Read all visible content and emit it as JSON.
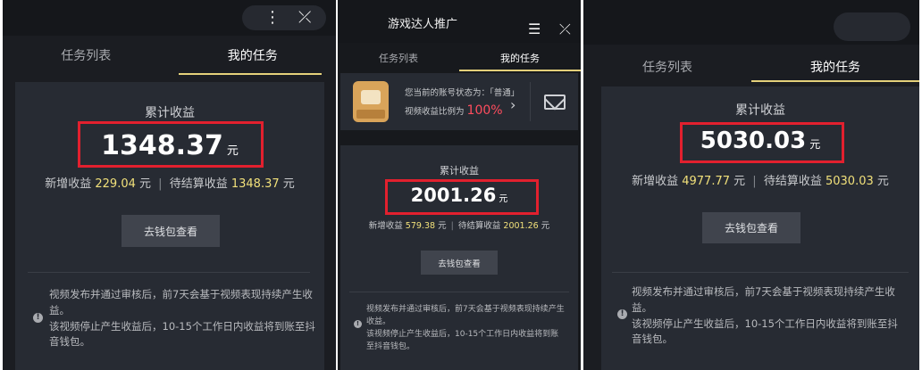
{
  "left": {
    "tabs": [
      "任务列表",
      "我的任务"
    ],
    "earnings_title": "累计收益",
    "amount": "1348.37",
    "unit": "元",
    "new_label": "新增收益",
    "new_value": "229.04",
    "pending_label": "待结算收益",
    "pending_value": "1348.37",
    "button": "去钱包查看",
    "notes": [
      "视频发布并通过审核后，前7天会基于视频表现持续产生收益。",
      "该视频停止产生收益后，10-15个工作日内收益将到账至抖音钱包。"
    ]
  },
  "middle": {
    "app_title": "游戏达人推广",
    "tabs": [
      "任务列表",
      "我的任务"
    ],
    "status_text": "您当前的账号状态为：「普通」",
    "ratio_label": "视频收益比例为",
    "ratio_value": "100%",
    "earnings_title": "累计收益",
    "amount": "2001.26",
    "unit": "元",
    "new_label": "新增收益",
    "new_value": "579.38",
    "pending_label": "待结算收益",
    "pending_value": "2001.26",
    "button": "去钱包查看",
    "notes": [
      "视频发布并通过审核后，前7天会基于视频表现持续产生收益。",
      "该视频停止产生收益后，10-15个工作日内收益将到账至抖音钱包。"
    ]
  },
  "right": {
    "tabs": [
      "任务列表",
      "我的任务"
    ],
    "earnings_title": "累计收益",
    "amount": "5030.03",
    "unit": "元",
    "new_label": "新增收益",
    "new_value": "4977.77",
    "pending_label": "待结算收益",
    "pending_value": "5030.03",
    "button": "去钱包查看",
    "notes": [
      "视频发布并通过审核后，前7天会基于视频表现持续产生收益。",
      "该视频停止产生收益后，10-15个工作日内收益将到账至抖音钱包。"
    ]
  },
  "colors": {
    "highlight_box": "#e2202e",
    "stat_value": "#f1e07a",
    "tab_underline": "#e4d07a",
    "ratio": "#ff4d5e"
  }
}
